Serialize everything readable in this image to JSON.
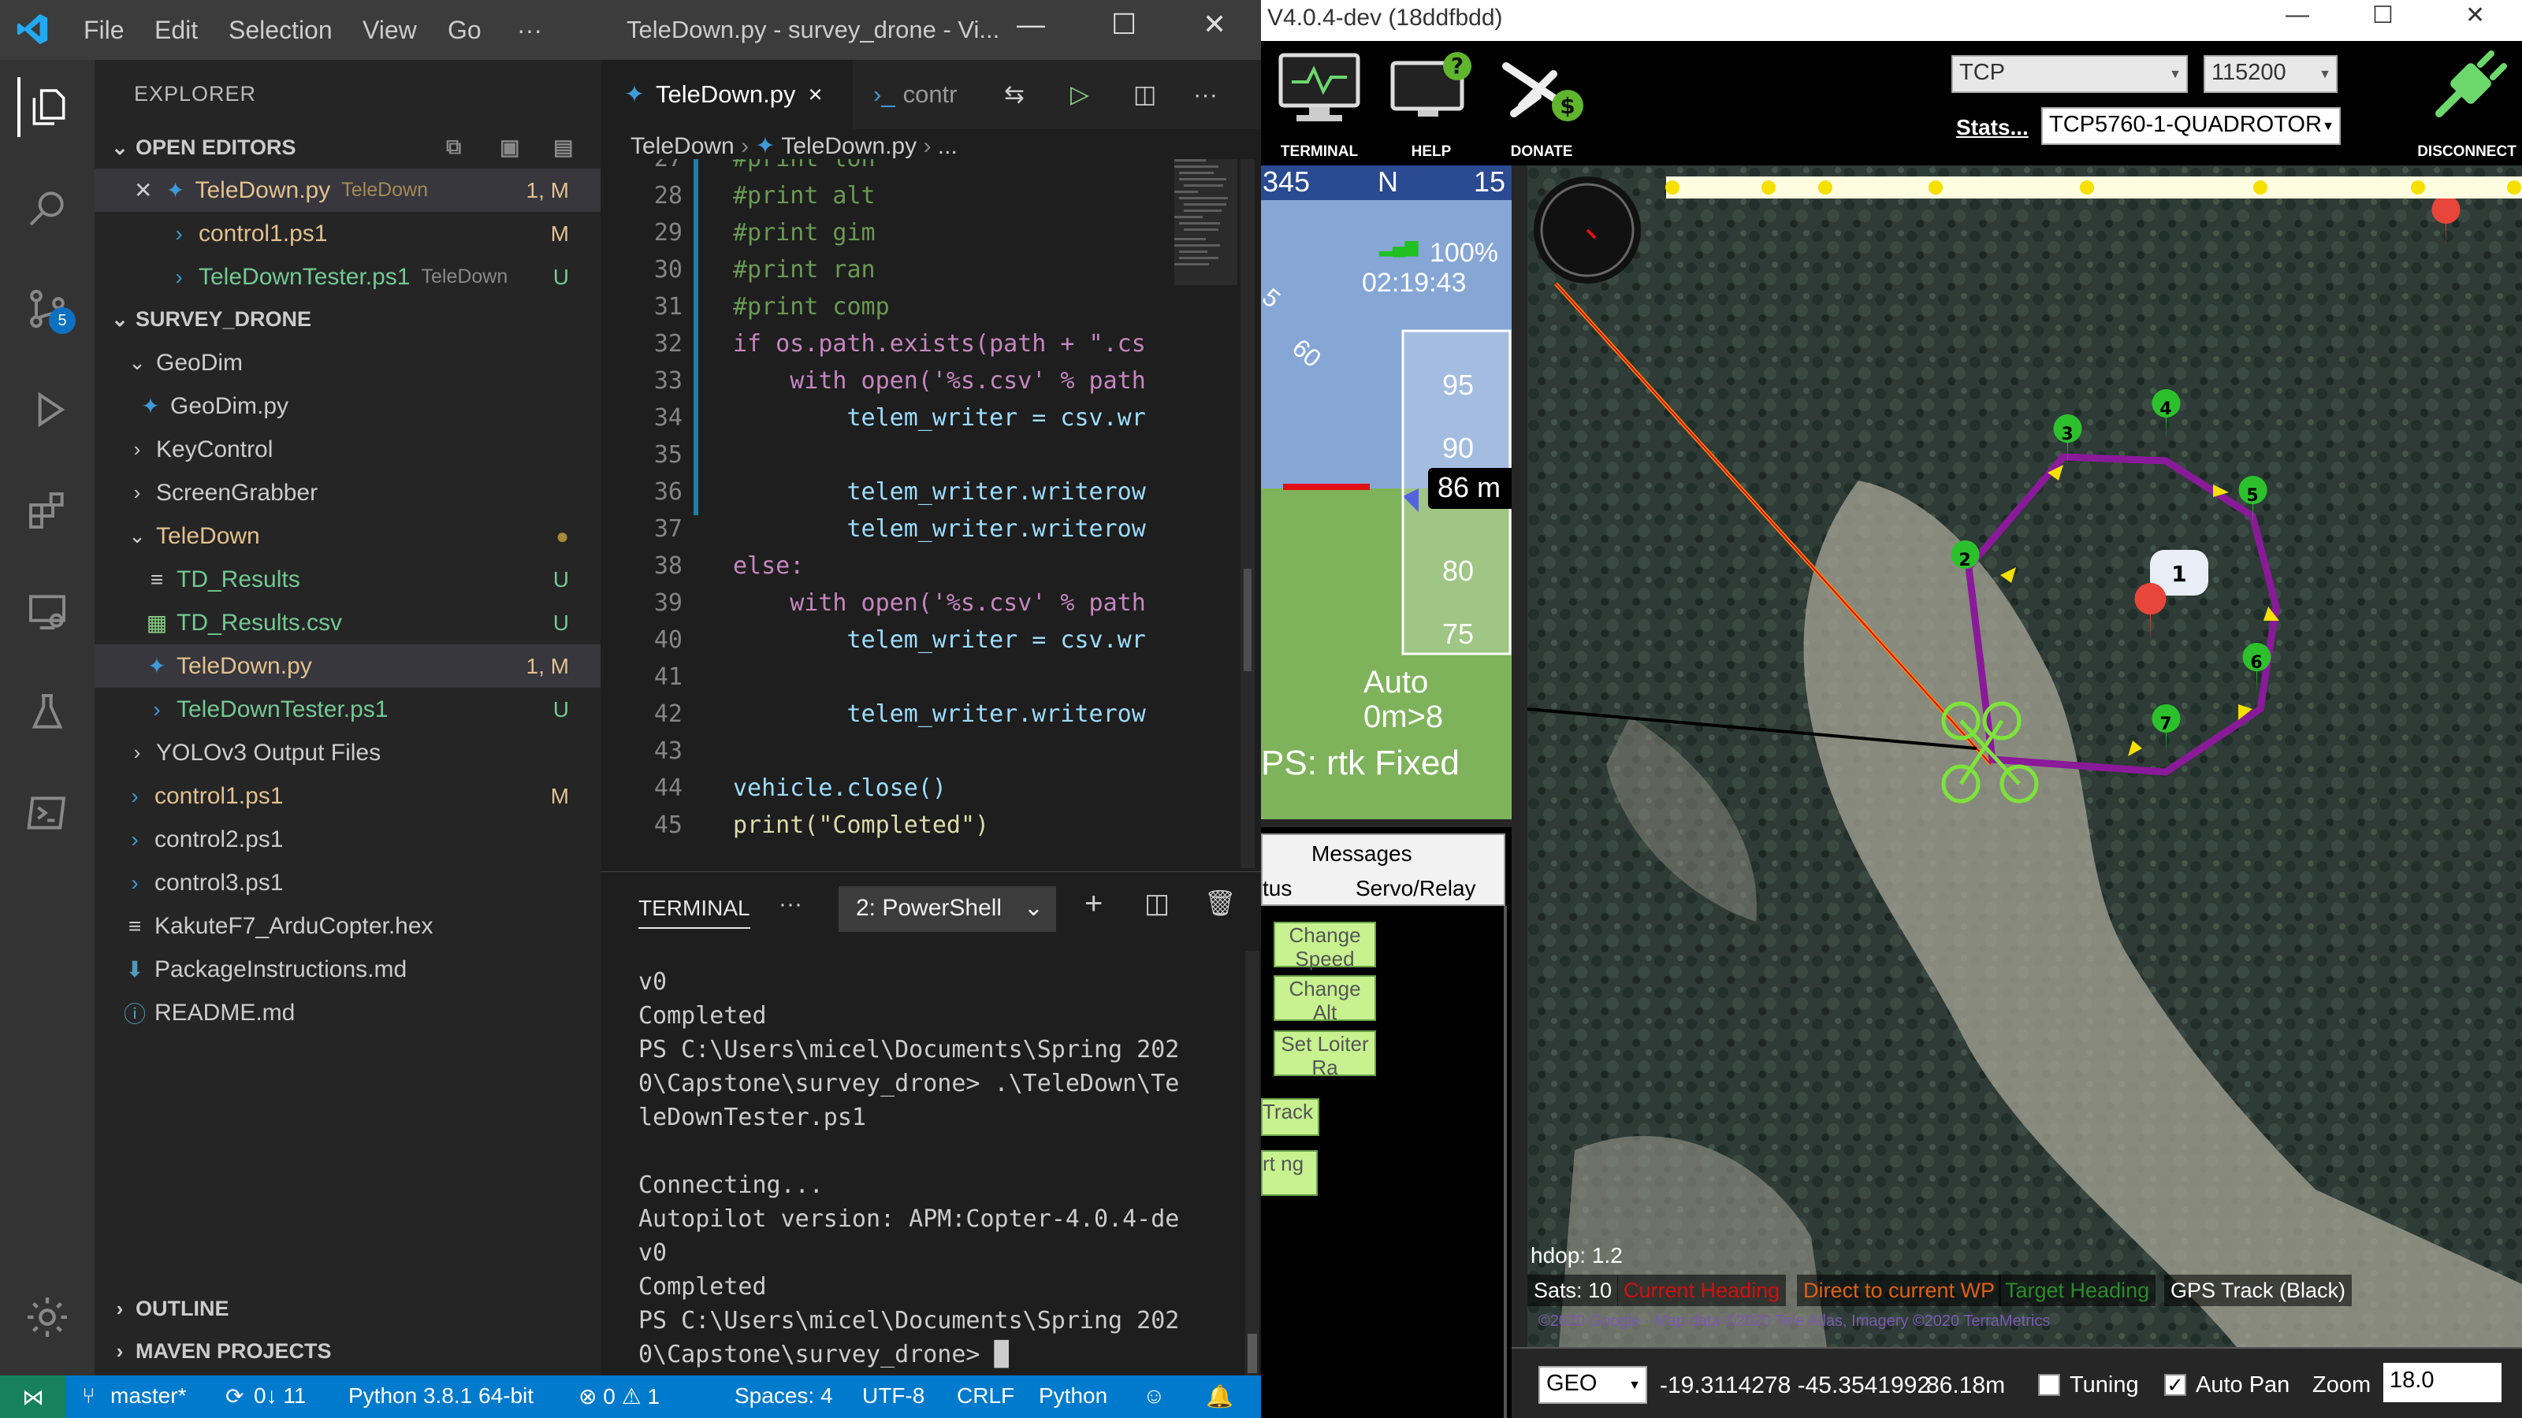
{
  "vscode": {
    "menu": [
      "File",
      "Edit",
      "Selection",
      "View",
      "Go",
      "···"
    ],
    "window_title": "TeleDown.py - survey_drone - Vi...",
    "scm_badge": "5",
    "explorer": {
      "title": "EXPLORER",
      "open_editors_label": "OPEN EDITORS",
      "open_editors": [
        {
          "name": "TeleDown.py",
          "sub": "TeleDown",
          "status": "1, M"
        },
        {
          "name": "control1.ps1",
          "sub": "",
          "status": "M"
        },
        {
          "name": "TeleDownTester.ps1",
          "sub": "TeleDown",
          "status": "U"
        }
      ],
      "project_label": "SURVEY_DRONE",
      "tree": [
        {
          "name": "GeoDim",
          "status": ""
        },
        {
          "name": "GeoDim.py",
          "status": ""
        },
        {
          "name": "KeyControl",
          "status": ""
        },
        {
          "name": "ScreenGrabber",
          "status": ""
        },
        {
          "name": "TeleDown",
          "status": "●"
        },
        {
          "name": "TD_Results",
          "status": "U"
        },
        {
          "name": "TD_Results.csv",
          "status": "U"
        },
        {
          "name": "TeleDown.py",
          "status": "1, M"
        },
        {
          "name": "TeleDownTester.ps1",
          "status": "U"
        },
        {
          "name": "YOLOv3 Output Files",
          "status": ""
        },
        {
          "name": "control1.ps1",
          "status": "M"
        },
        {
          "name": "control2.ps1",
          "status": ""
        },
        {
          "name": "control3.ps1",
          "status": ""
        },
        {
          "name": "KakuteF7_ArduCopter.hex",
          "status": ""
        },
        {
          "name": "PackageInstructions.md",
          "status": ""
        },
        {
          "name": "README.md",
          "status": ""
        }
      ],
      "outline_label": "OUTLINE",
      "maven_label": "MAVEN PROJECTS"
    },
    "tabs": [
      {
        "label": "TeleDown.py",
        "close": "×"
      },
      {
        "label": "contr"
      }
    ],
    "breadcrumb": [
      "TeleDown",
      "TeleDown.py",
      "..."
    ],
    "code_lines": [
      {
        "n": "27",
        "t": "#print lon"
      },
      {
        "n": "28",
        "t": "#print alt"
      },
      {
        "n": "29",
        "t": "#print gim"
      },
      {
        "n": "30",
        "t": "#print ran"
      },
      {
        "n": "31",
        "t": "#print comp"
      },
      {
        "n": "32",
        "t": "if os.path.exists(path + \".cs"
      },
      {
        "n": "33",
        "t": "    with open('%s.csv' % path"
      },
      {
        "n": "34",
        "t": "        telem_writer = csv.wr"
      },
      {
        "n": "35",
        "t": ""
      },
      {
        "n": "36",
        "t": "        telem_writer.writerow"
      },
      {
        "n": "37",
        "t": "        telem_writer.writerow"
      },
      {
        "n": "38",
        "t": "else:"
      },
      {
        "n": "39",
        "t": "    with open('%s.csv' % path"
      },
      {
        "n": "40",
        "t": "        telem_writer = csv.wr"
      },
      {
        "n": "41",
        "t": ""
      },
      {
        "n": "42",
        "t": "        telem_writer.writerow"
      },
      {
        "n": "43",
        "t": ""
      },
      {
        "n": "44",
        "t": "vehicle.close()"
      },
      {
        "n": "45",
        "t": "print(\"Completed\")"
      }
    ],
    "terminal": {
      "tab_label": "TERMINAL",
      "more": "···",
      "shell": "2: PowerShell",
      "output": "v0\nCompleted\nPS C:\\Users\\micel\\Documents\\Spring 202\n0\\Capstone\\survey_drone> .\\TeleDown\\Te\nleDownTester.ps1\n\nConnecting...\nAutopilot version: APM:Copter-4.0.4-de\nv0\nCompleted\nPS C:\\Users\\micel\\Documents\\Spring 202\n0\\Capstone\\survey_drone> "
    },
    "statusbar": {
      "branch": "master*",
      "sync": "0↓ 11",
      "python": "Python 3.8.1 64-bit",
      "problems": "⊗ 0 ⚠ 1",
      "spaces": "Spaces: 4",
      "encoding": "UTF-8",
      "eol": "CRLF",
      "language": "Python"
    }
  },
  "mission_planner": {
    "title": "V4.0.4-dev (18ddfbdd)",
    "toolbar": {
      "terminal": "TERMINAL",
      "help": "HELP",
      "donate": "DONATE",
      "disconnect": "DISCONNECT"
    },
    "connection": {
      "type": "TCP",
      "baud": "115200",
      "stats_label": "Stats...",
      "link": "TCP5760-1-QUADROTOR"
    },
    "hud": {
      "heading_left": "345",
      "heading_n": "N",
      "heading_right": "15",
      "battery": "100%",
      "time": "02:19:43",
      "alt_ticks": [
        "95",
        "90",
        "80",
        "75"
      ],
      "alt_value": "86 m",
      "mode": "Auto",
      "wp_info": "0m>8",
      "gps": "PS: rtk Fixed",
      "pitch_labels": [
        "5",
        "60"
      ]
    },
    "tabs": {
      "messages": "Messages",
      "status": "tus",
      "servo": "Servo/Relay"
    },
    "action_buttons": [
      "Change Speed",
      "Change Alt",
      "Set Loiter Ra",
      "Track",
      "rt ng"
    ],
    "map": {
      "hdop": "hdop: 1.2",
      "sats": "Sats: 10",
      "legend": [
        {
          "label": "Current Heading",
          "color": "#d01010"
        },
        {
          "label": "Direct to current WP",
          "color": "#e06010"
        },
        {
          "label": "Target Heading",
          "color": "#2a8a2a"
        },
        {
          "label": "GPS Track (Black)",
          "color": "#ffffff"
        }
      ],
      "copyright": "©2020 Google · Map data ©2020 Tele Atlas, Imagery ©2020 TerraMetrics",
      "waypoints": [
        "2",
        "3",
        "4",
        "5",
        "6",
        "7"
      ],
      "center_label": "1"
    },
    "bottom": {
      "coord_type": "GEO",
      "coords": "-19.3114278 -45.3541992",
      "alt": "86.18m",
      "tuning_label": "Tuning",
      "autopan_label": "Auto Pan",
      "zoom_label": "Zoom",
      "zoom_value": "18.0"
    }
  }
}
